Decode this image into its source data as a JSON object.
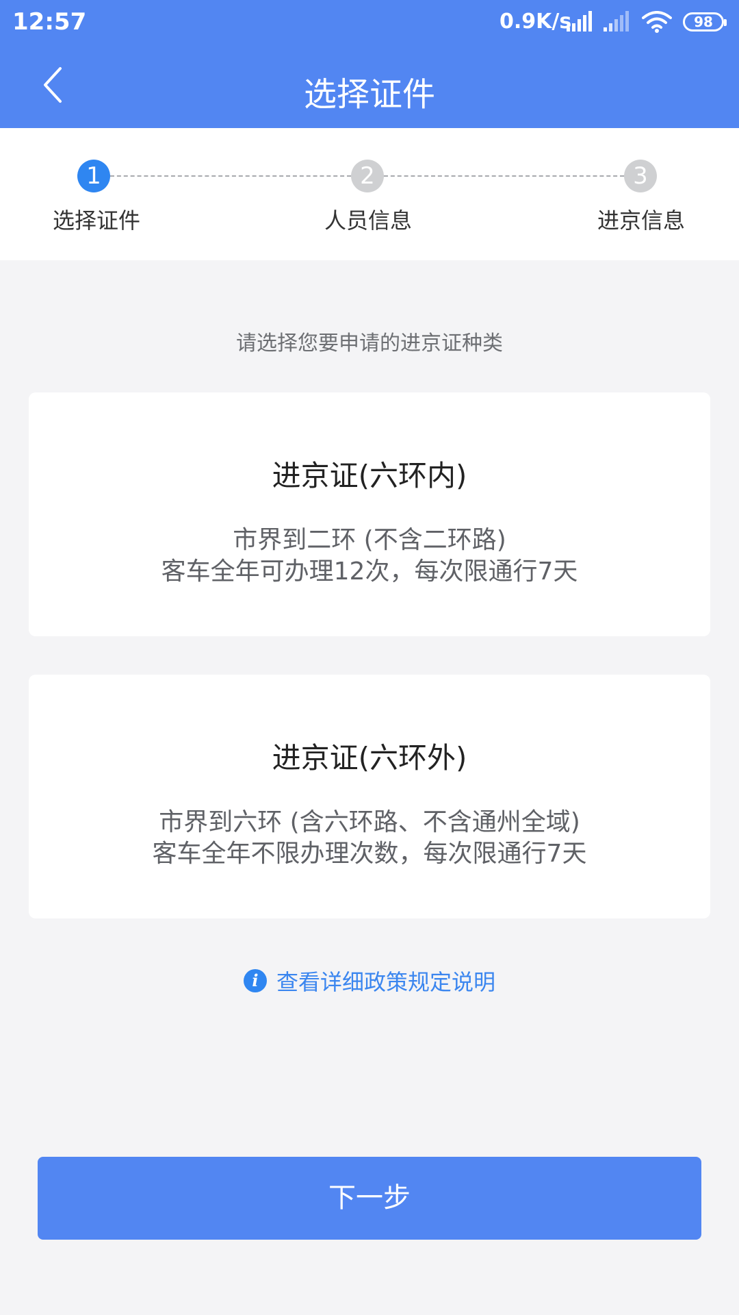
{
  "status_bar": {
    "time": "12:57",
    "net_speed": "0.9K/s",
    "battery": "98",
    "icons": [
      "signal-icon",
      "signal-icon",
      "wifi-icon",
      "battery-icon"
    ]
  },
  "nav": {
    "back_icon": "chevron-left-icon",
    "title": "选择证件"
  },
  "steps": [
    {
      "number": "1",
      "label": "选择证件",
      "active": true
    },
    {
      "number": "2",
      "label": "人员信息",
      "active": false
    },
    {
      "number": "3",
      "label": "进京信息",
      "active": false
    }
  ],
  "prompt": "请选择您要申请的进京证种类",
  "cards": [
    {
      "title": "进京证(六环内)",
      "line1": "市界到二环 (不含二环路)",
      "line2": "客车全年可办理12次，每次限通行7天"
    },
    {
      "title": "进京证(六环外)",
      "line1": "市界到六环 (含六环路、不含通州全域)",
      "line2": "客车全年不限办理次数，每次限通行7天"
    }
  ],
  "policy": {
    "icon": "info-icon",
    "text": "查看详细政策规定说明"
  },
  "next_button": "下一步",
  "colors": {
    "primary": "#5286f2",
    "accent": "#2f86f1",
    "background": "#f4f4f6",
    "link": "#3b86ef"
  }
}
